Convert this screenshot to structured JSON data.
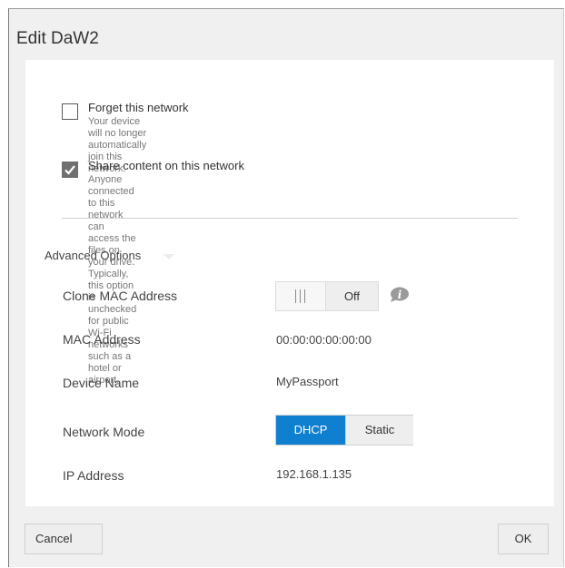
{
  "dialog": {
    "title": "Edit DaW2"
  },
  "network_options": {
    "forget": {
      "label": "Forget this network",
      "description": "Your device will no longer automatically join this network.",
      "checked": false
    },
    "share": {
      "label": "Share content on this network",
      "description_line1": "Anyone connected to this network can access the files on your drive. Typically, this option is",
      "description_line2": "unchecked for public Wi-Fi networks such as a hotel or airport.",
      "checked": true
    }
  },
  "advanced": {
    "title": "Advanced Options",
    "clone_mac": {
      "label": "Clone MAC Address",
      "toggle_state": "Off",
      "info_icon": "info-icon"
    },
    "mac_address": {
      "label": "MAC Address",
      "value": "00:00:00:00:00:00"
    },
    "device_name": {
      "label": "Device Name",
      "value": "MyPassport"
    },
    "network_mode": {
      "label": "Network Mode",
      "options": [
        "DHCP",
        "Static"
      ],
      "selected": "DHCP"
    },
    "ip_address": {
      "label": "IP Address",
      "value": "192.168.1.135"
    }
  },
  "footer": {
    "cancel_label": "Cancel",
    "ok_label": "OK"
  },
  "colors": {
    "accent": "#0f7fcf",
    "panel_background": "#f0f0f0",
    "content_background": "#ffffff",
    "checkbox_checked": "#6f6f6f"
  }
}
